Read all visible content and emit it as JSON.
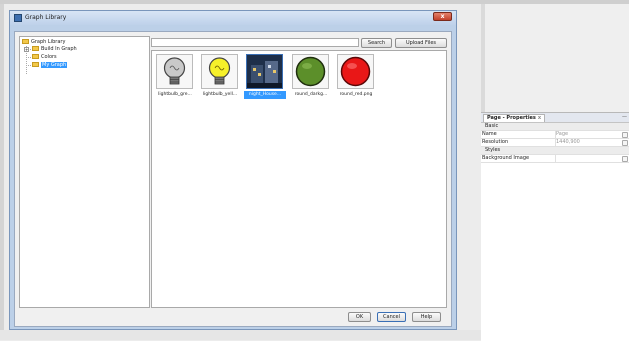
{
  "dialog": {
    "title": "Graph Library",
    "close_label": "x"
  },
  "tree": {
    "items": [
      {
        "label": "Graph Library",
        "expander": ""
      },
      {
        "label": "Build In Graph",
        "expander": "+"
      },
      {
        "label": "Colors",
        "expander": ""
      },
      {
        "label": "My Graph",
        "expander": ""
      }
    ]
  },
  "search": {
    "value": "",
    "placeholder": "",
    "search_label": "Search",
    "upload_label": "Upload Files"
  },
  "thumbnails": [
    {
      "caption": "lightbulb_gre...",
      "icon": "lightbulb-off-icon"
    },
    {
      "caption": "lightbulb_yell...",
      "icon": "lightbulb-on-icon"
    },
    {
      "caption": "night_House...",
      "icon": "night-house-icon"
    },
    {
      "caption": "round_darkg...",
      "icon": "round-darkgreen-icon"
    },
    {
      "caption": "round_red.png",
      "icon": "round-red-icon"
    }
  ],
  "footer": {
    "ok_label": "OK",
    "cancel_label": "Cancel",
    "help_label": "Help"
  },
  "properties_panel": {
    "tab_label": "Page - Properties",
    "tab_close": "x",
    "minimize_label": "—",
    "sections": [
      {
        "label": "Basic"
      },
      {
        "label": "Styles"
      }
    ],
    "rows": [
      {
        "key": "Name",
        "value": "Page"
      },
      {
        "key": "Resolution",
        "value": "1440,900"
      },
      {
        "key": "Background Image",
        "value": ""
      }
    ]
  },
  "colors": {
    "selection": "#3399ff",
    "dialog_frame": "#bcd0e8",
    "close_button": "#c2402a"
  }
}
